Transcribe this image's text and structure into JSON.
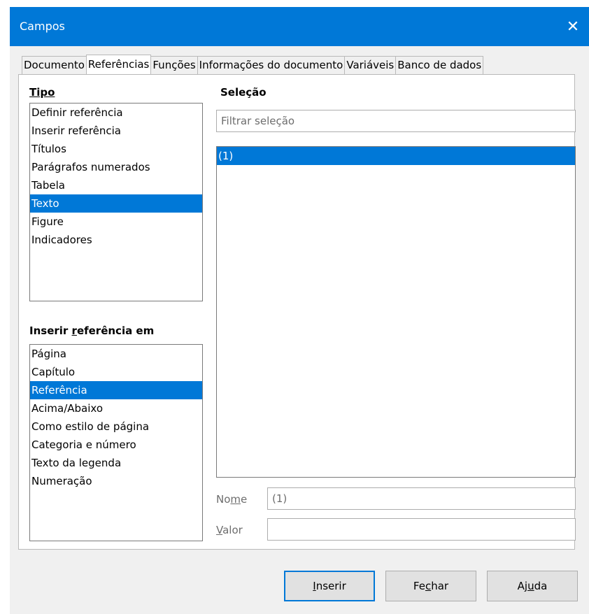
{
  "dialog": {
    "title": "Campos"
  },
  "tabs": [
    {
      "label": "Documento"
    },
    {
      "label": "Referências"
    },
    {
      "label": "Funções"
    },
    {
      "label": "Informações do documento"
    },
    {
      "label": "Variáveis"
    },
    {
      "label": "Banco de dados"
    }
  ],
  "active_tab": "Referências",
  "type_section": {
    "label": "Tipo",
    "items": [
      "Definir referência",
      "Inserir referência",
      "Títulos",
      "Parágrafos numerados",
      "Tabela",
      "Texto",
      "Figure",
      "Indicadores"
    ],
    "selected": "Texto"
  },
  "insert_ref_section": {
    "label_pre": "Inserir ",
    "label_u": "r",
    "label_post": "eferência em",
    "items": [
      "Página",
      "Capítulo",
      "Referência",
      "Acima/Abaixo",
      "Como estilo de página",
      "Categoria e número",
      "Texto da legenda",
      "Numeração"
    ],
    "selected": "Referência"
  },
  "selection_section": {
    "label": "Seleção",
    "filter_placeholder": "Filtrar seleção",
    "items": [
      "(1)"
    ],
    "selected": "(1)"
  },
  "name_field": {
    "label_pre": "No",
    "label_u": "m",
    "label_post": "e",
    "value": "(1)"
  },
  "value_field": {
    "label_u": "V",
    "label_post": "alor",
    "value": ""
  },
  "buttons": {
    "insert": {
      "label_u": "I",
      "label_post": "nserir"
    },
    "close": {
      "label_pre": "Fe",
      "label_u": "c",
      "label_post": "har"
    },
    "help": {
      "label_pre": "Aj",
      "label_u": "u",
      "label_post": "da"
    }
  },
  "colors": {
    "accent": "#0078d7",
    "selection": "#0078d7"
  }
}
